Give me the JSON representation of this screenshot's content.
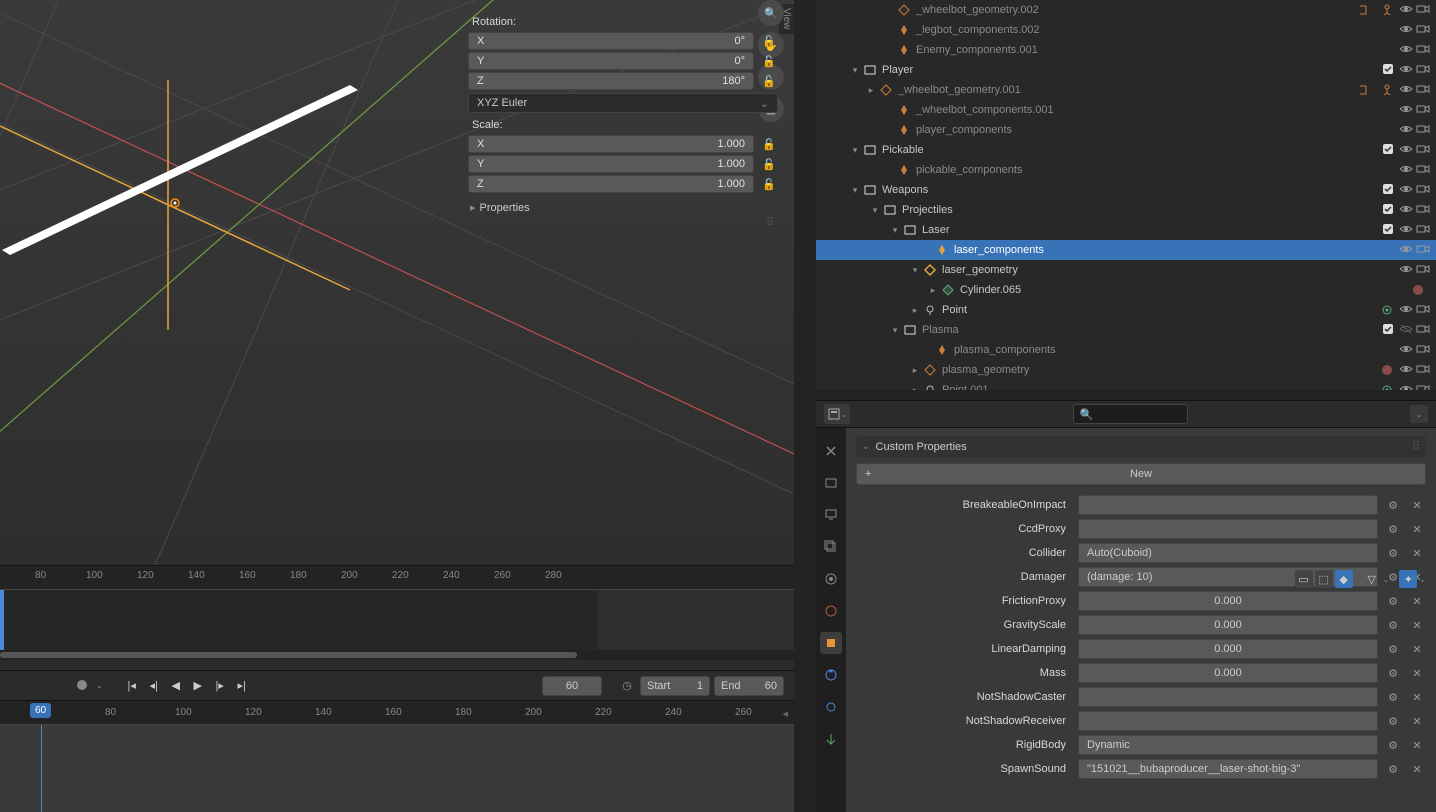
{
  "transform": {
    "rotation_label": "Rotation:",
    "rot": {
      "x": "0°",
      "y": "0°",
      "z": "180°"
    },
    "mode": "XYZ Euler",
    "scale_label": "Scale:",
    "scale": {
      "x": "1.000",
      "y": "1.000",
      "z": "1.000"
    },
    "props_label": "Properties"
  },
  "axes": {
    "x": "X",
    "y": "Y",
    "z": "Z"
  },
  "view_tab": "View",
  "outliner": {
    "rows": [
      {
        "indent": 60,
        "arr": "",
        "icon": "mesh",
        "name": "_wheelbot_geometry.002",
        "dim": true,
        "ext": [
          "arm",
          "pose"
        ],
        "ctrls": [
          "eye",
          "cam"
        ]
      },
      {
        "indent": 60,
        "arr": "",
        "icon": "armbone",
        "name": "_legbot_components.002",
        "dim": true,
        "ctrls": [
          "eye",
          "cam"
        ]
      },
      {
        "indent": 60,
        "arr": "",
        "icon": "armbone",
        "name": "Enemy_components.001",
        "dim": true,
        "ctrls": [
          "eye",
          "cam"
        ]
      },
      {
        "indent": 26,
        "arr": "▾",
        "icon": "coll",
        "name": "Player",
        "ctrls": [
          "chk",
          "eye",
          "cam"
        ]
      },
      {
        "indent": 42,
        "arr": "▸",
        "icon": "mesh",
        "name": "_wheelbot_geometry.001",
        "dim": true,
        "ext": [
          "arm",
          "pose"
        ],
        "ctrls": [
          "eye",
          "cam"
        ]
      },
      {
        "indent": 60,
        "arr": "",
        "icon": "armbone",
        "name": "_wheelbot_components.001",
        "dim": true,
        "ctrls": [
          "eye",
          "cam"
        ]
      },
      {
        "indent": 60,
        "arr": "",
        "icon": "armbone",
        "name": "player_components",
        "dim": true,
        "ctrls": [
          "eye",
          "cam"
        ]
      },
      {
        "indent": 26,
        "arr": "▾",
        "icon": "coll",
        "name": "Pickable",
        "ctrls": [
          "chk",
          "eye",
          "cam"
        ]
      },
      {
        "indent": 60,
        "arr": "",
        "icon": "armbone",
        "name": "pickable_components",
        "dim": true,
        "ctrls": [
          "eye",
          "cam"
        ]
      },
      {
        "indent": 26,
        "arr": "▾",
        "icon": "coll",
        "name": "Weapons",
        "ctrls": [
          "chk",
          "eye",
          "cam"
        ]
      },
      {
        "indent": 46,
        "arr": "▾",
        "icon": "coll",
        "name": "Projectiles",
        "ctrls": [
          "chk",
          "eye",
          "cam"
        ]
      },
      {
        "indent": 66,
        "arr": "▾",
        "icon": "coll",
        "name": "Laser",
        "ctrls": [
          "chk",
          "eye",
          "cam"
        ]
      },
      {
        "indent": 98,
        "arr": "",
        "icon": "armbone-o",
        "name": "laser_components",
        "sel": true,
        "ctrls": [
          "eye",
          "cam"
        ]
      },
      {
        "indent": 86,
        "arr": "▾",
        "icon": "mesh-o",
        "name": "laser_geometry",
        "ctrls": [
          "eye",
          "cam"
        ]
      },
      {
        "indent": 104,
        "arr": "▸",
        "icon": "meshdata",
        "name": "Cylinder.065",
        "ext": [
          "mat"
        ],
        "ctrls": []
      },
      {
        "indent": 86,
        "arr": "▸",
        "icon": "light",
        "name": "Point",
        "ext": [
          "lightdata"
        ],
        "ctrls": [
          "eye",
          "cam"
        ]
      },
      {
        "indent": 66,
        "arr": "▾",
        "icon": "coll",
        "name": "Plasma",
        "dim": true,
        "ctrls": [
          "chk",
          "eyeo",
          "cam"
        ]
      },
      {
        "indent": 98,
        "arr": "",
        "icon": "armbone",
        "name": "plasma_components",
        "dim": true,
        "ctrls": [
          "eye",
          "cam"
        ]
      },
      {
        "indent": 86,
        "arr": "▸",
        "icon": "mesh",
        "name": "plasma_geometry",
        "dim": true,
        "ext": [
          "mat"
        ],
        "ctrls": [
          "eye",
          "cam"
        ]
      },
      {
        "indent": 86,
        "arr": "▸",
        "icon": "light",
        "name": "Point.001",
        "dim": true,
        "ext": [
          "lightdata"
        ],
        "ctrls": [
          "eye",
          "cam"
        ]
      }
    ]
  },
  "properties": {
    "panel_title": "Custom Properties",
    "new_label": "New",
    "rows": [
      {
        "label": "BreakeableOnImpact",
        "value": "",
        "align": "left"
      },
      {
        "label": "CcdProxy",
        "value": "",
        "align": "left"
      },
      {
        "label": "Collider",
        "value": "Auto(Cuboid)",
        "align": "left"
      },
      {
        "label": "Damager",
        "value": "(damage: 10)",
        "align": "left"
      },
      {
        "label": "FrictionProxy",
        "value": "0.000",
        "align": "center"
      },
      {
        "label": "GravityScale",
        "value": "0.000",
        "align": "center"
      },
      {
        "label": "LinearDamping",
        "value": "0.000",
        "align": "center"
      },
      {
        "label": "Mass",
        "value": "0.000",
        "align": "center"
      },
      {
        "label": "NotShadowCaster",
        "value": "",
        "align": "left"
      },
      {
        "label": "NotShadowReceiver",
        "value": "",
        "align": "left"
      },
      {
        "label": "RigidBody",
        "value": "Dynamic",
        "align": "left"
      },
      {
        "label": "SpawnSound",
        "value": "\"151021__bubaproducer__laser-shot-big-3\"",
        "align": "left"
      }
    ]
  },
  "timeline": {
    "ruler1": [
      "80",
      "100",
      "120",
      "140",
      "160",
      "180",
      "200",
      "220",
      "240",
      "260",
      "280"
    ],
    "frame": "60",
    "start_label": "Start",
    "start_val": "1",
    "end_label": "End",
    "end_val": "60",
    "current": "60",
    "ruler2": [
      "80",
      "100",
      "120",
      "140",
      "160",
      "180",
      "200",
      "220",
      "240",
      "260"
    ]
  },
  "colors": {
    "accent": "#3873b8",
    "axis_x": "#c54f4f",
    "axis_y": "#6fa23e",
    "axis_z": "#e8a33d"
  }
}
